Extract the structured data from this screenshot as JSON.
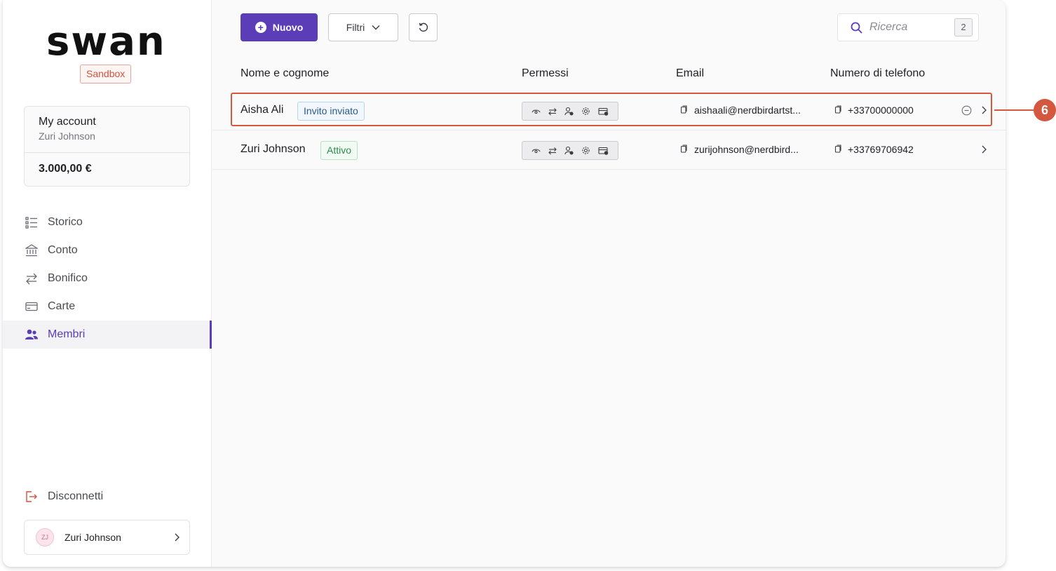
{
  "brand": {
    "logo_text": "swan",
    "env_badge": "Sandbox"
  },
  "account": {
    "title": "My account",
    "holder": "Zuri Johnson",
    "balance": "3.000,00 €"
  },
  "nav": {
    "items": [
      {
        "label": "Storico",
        "icon": "list-icon"
      },
      {
        "label": "Conto",
        "icon": "bank-icon"
      },
      {
        "label": "Bonifico",
        "icon": "transfer-icon"
      },
      {
        "label": "Carte",
        "icon": "card-icon"
      },
      {
        "label": "Membri",
        "icon": "members-icon",
        "active": true
      }
    ],
    "logout": "Disconnetti"
  },
  "user": {
    "initials": "ZJ",
    "name": "Zuri Johnson"
  },
  "toolbar": {
    "new_label": "Nuovo",
    "filter_label": "Filtri",
    "search_placeholder": "Ricerca",
    "search_count": "2"
  },
  "table": {
    "columns": [
      "Nome e cognome",
      "Permessi",
      "Email",
      "Numero di telefono"
    ],
    "rows": [
      {
        "name": "Aisha Ali",
        "status": "Invito inviato",
        "email": "aishaali@nerdbirdartst...",
        "phone": "+33700000000"
      },
      {
        "name": "Zuri Johnson",
        "status": "Attivo",
        "email": "zurijohnson@nerdbird...",
        "phone": "+33769706942"
      }
    ]
  },
  "callout": {
    "number": "6"
  },
  "colors": {
    "accent": "#5b3db7",
    "highlight": "#d4573f"
  }
}
